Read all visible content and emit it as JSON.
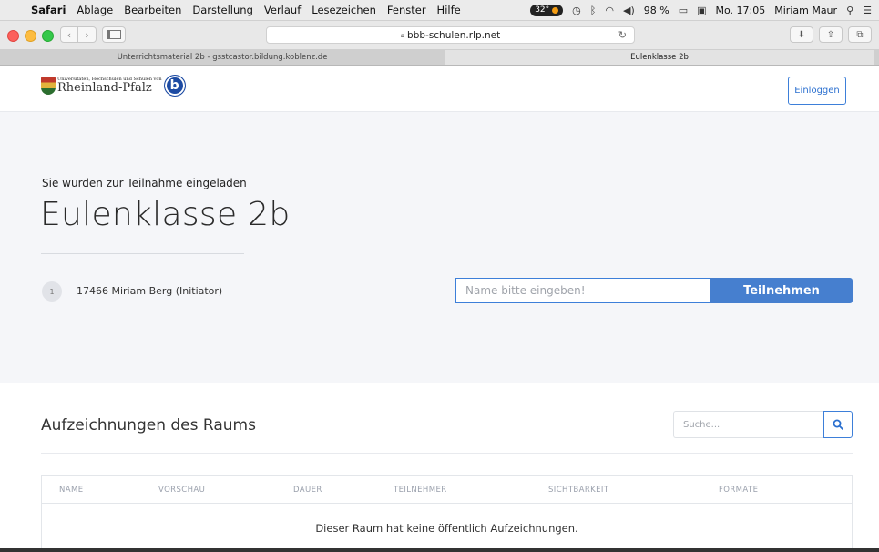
{
  "menubar": {
    "items": [
      "Safari",
      "Ablage",
      "Bearbeiten",
      "Darstellung",
      "Verlauf",
      "Lesezeichen",
      "Fenster",
      "Hilfe"
    ],
    "temperature": "32°",
    "battery": "98 %",
    "datetime": "Mo. 17:05",
    "user": "Miriam Maur"
  },
  "browser": {
    "url": "bbb-schulen.rlp.net",
    "tabs": [
      {
        "label": "Unterrichtsmaterial 2b - gsstcastor.bildung.koblenz.de",
        "active": false
      },
      {
        "label": "Eulenklasse 2b",
        "active": true
      }
    ]
  },
  "header": {
    "logo_small": "Universitäten, Hochschulen und Schulen von",
    "logo_big": "Rheinland-Pfalz",
    "logo_badge": "b",
    "login_label": "Einloggen"
  },
  "hero": {
    "invite_text": "Sie wurden zur Teilnahme eingeladen",
    "room_name": "Eulenklasse 2b",
    "participant_count": "1",
    "owner": "17466 Miriam Berg (Initiator)",
    "name_placeholder": "Name bitte eingeben!",
    "join_label": "Teilnehmen"
  },
  "recordings": {
    "title": "Aufzeichnungen des Raums",
    "search_placeholder": "Suche...",
    "columns": [
      "NAME",
      "VORSCHAU",
      "DAUER",
      "TEILNEHMER",
      "SICHTBARKEIT",
      "FORMATE"
    ],
    "empty_message": "Dieser Raum hat keine öffentlich Aufzeichnungen."
  },
  "colors": {
    "accent": "#467fcf",
    "hero_bg": "#f5f6f9"
  }
}
